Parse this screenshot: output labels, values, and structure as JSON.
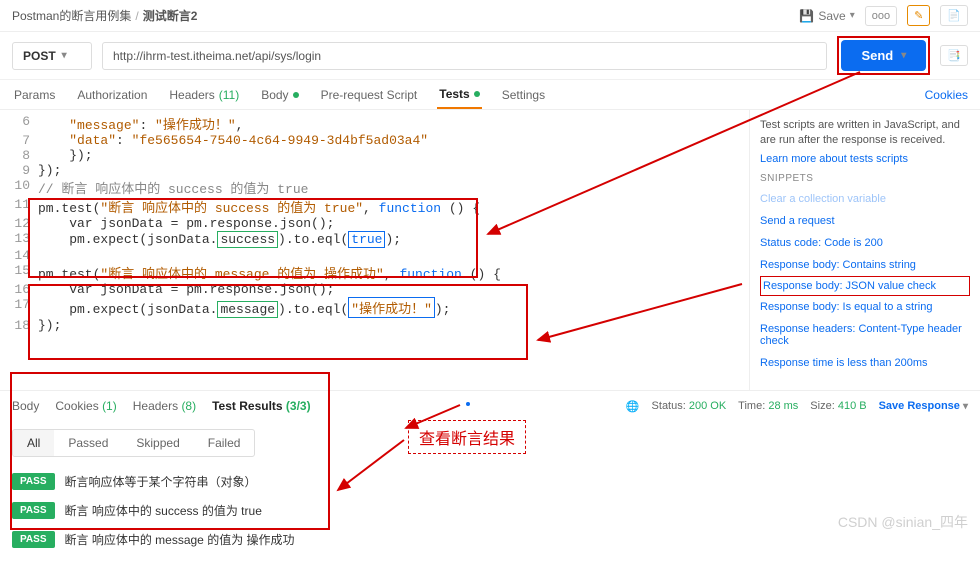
{
  "breadcrumb": {
    "collection": "Postman的断言用例集",
    "item": "测试断言2"
  },
  "toolbar": {
    "save": "Save"
  },
  "request": {
    "method": "POST",
    "url": "http://ihrm-test.itheima.net/api/sys/login",
    "send": "Send"
  },
  "tabs": {
    "params": "Params",
    "auth": "Authorization",
    "headers": "Headers",
    "headers_count": "(11)",
    "body": "Body",
    "prereq": "Pre-request Script",
    "tests": "Tests",
    "settings": "Settings",
    "cookies": "Cookies"
  },
  "code": {
    "l6a": "\"message\"",
    "l6b": "\"操作成功！\"",
    "l7a": "\"data\"",
    "l7b": "\"fe565654-7540-4c64-9949-3d4bf5ad03a4\"",
    "l8": "    });",
    "l9": "});",
    "l10": "// 断言 响应体中的 success 的值为 true",
    "l11a": "pm.test(",
    "l11b": "\"断言 响应体中的 success 的值为 true\"",
    "l11c": "function",
    "l11d": " () {",
    "l12a": "    var jsonData = pm.response.json();",
    "l13a": "    pm.expect(jsonData.",
    "l13b": "success",
    "l13c": ").to.eql(",
    "l13d": "true",
    "l13e": ");",
    "l15a": "pm.test(",
    "l15b": "\"断言 响应体中的 message 的值为 操作成功\"",
    "l15c": "function",
    "l15d": " () {",
    "l16a": "    var jsonData = pm.response.json();",
    "l17a": "    pm.expect(jsonData.",
    "l17b": "message",
    "l17c": ").to.eql(",
    "l17d": "\"操作成功！\"",
    "l17e": ");",
    "l18": "});"
  },
  "side": {
    "desc1": "Test scripts are written in JavaScript, and are run after the response is received.",
    "learn": "Learn more about tests scripts",
    "hdr": "SNIPPETS",
    "s0": "Clear a collection variable",
    "s1": "Send a request",
    "s2": "Status code: Code is 200",
    "s3": "Response body: Contains string",
    "s4": "Response body: JSON value check",
    "s5": "Response body: Is equal to a string",
    "s6": "Response headers: Content-Type header check",
    "s7": "Response time is less than 200ms"
  },
  "resp": {
    "body": "Body",
    "cookies": "Cookies",
    "cookies_count": "(1)",
    "headers": "Headers",
    "headers_count": "(8)",
    "testres": "Test Results",
    "testres_count": "(3/3)",
    "status_l": "Status:",
    "status_v": "200 OK",
    "time_l": "Time:",
    "time_v": "28 ms",
    "size_l": "Size:",
    "size_v": "410 B",
    "save": "Save Response"
  },
  "filters": {
    "all": "All",
    "passed": "Passed",
    "skipped": "Skipped",
    "failed": "Failed"
  },
  "pass_label": "PASS",
  "tests_list": {
    "t1": "断言响应体等于某个字符串（对象）",
    "t2": "断言 响应体中的 success 的值为 true",
    "t3": "断言 响应体中的 message 的值为 操作成功"
  },
  "annotation": "查看断言结果",
  "watermark": "CSDN @sinian_四年"
}
